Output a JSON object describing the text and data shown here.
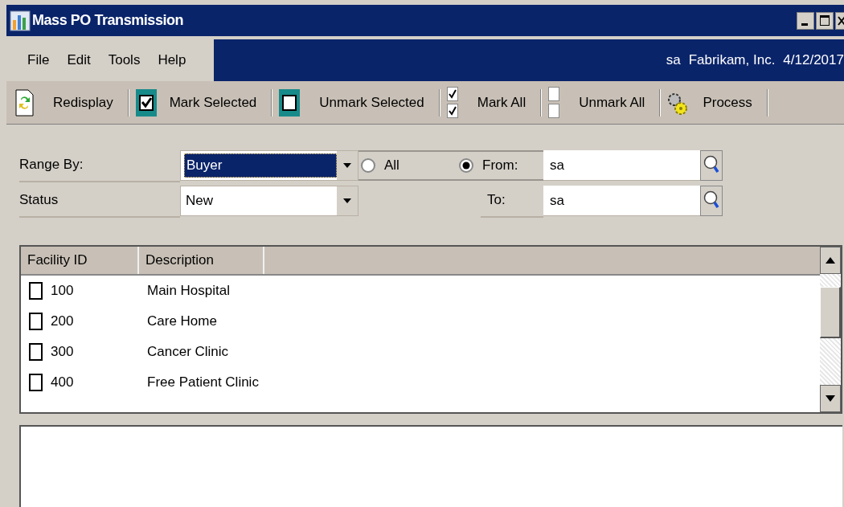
{
  "window": {
    "title": "Mass PO Transmission"
  },
  "menu": [
    "File",
    "Edit",
    "Tools",
    "Help"
  ],
  "session": {
    "user": "sa",
    "company": "Fabrikam, Inc.",
    "date": "4/12/2017"
  },
  "toolbar": [
    {
      "kind": "redisplay",
      "label": "Redisplay"
    },
    {
      "kind": "mark",
      "label": "Mark Selected"
    },
    {
      "kind": "unmark",
      "label": "Unmark Selected"
    },
    {
      "kind": "markall",
      "label": "Mark All"
    },
    {
      "kind": "unmarkall",
      "label": "Unmark All"
    },
    {
      "kind": "process",
      "label": "Process"
    }
  ],
  "form": {
    "range_by": {
      "label": "Range By:",
      "value": "Buyer"
    },
    "status": {
      "label": "Status",
      "value": "New"
    },
    "range_options": [
      {
        "label": "All",
        "selected": false
      },
      {
        "label": "From:",
        "selected": true
      }
    ],
    "from": {
      "value": "sa"
    },
    "to": {
      "label": "To:",
      "value": "sa"
    }
  },
  "table": {
    "columns": [
      "Facility ID",
      "Description"
    ],
    "rows": [
      {
        "id": "100",
        "description": "Main Hospital",
        "checked": false
      },
      {
        "id": "200",
        "description": "Care Home",
        "checked": false
      },
      {
        "id": "300",
        "description": "Cancer Clinic",
        "checked": false
      },
      {
        "id": "400",
        "description": "Free Patient Clinic",
        "checked": false
      }
    ]
  }
}
